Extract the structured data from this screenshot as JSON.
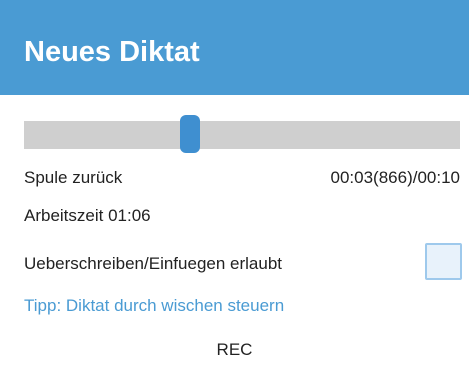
{
  "app_bar": {
    "title": "Neues Diktat",
    "color": "#4a9bd3"
  },
  "player": {
    "seek_progress": 0.38,
    "status": "Spule zurück",
    "time": "00:03(866)/00:10",
    "work_time": "Arbeitszeit 01:06"
  },
  "settings": {
    "overwrite_label": "Ueberschreiben/Einfuegen erlaubt",
    "overwrite_checked": false
  },
  "tip": "Tipp: Diktat durch wischen steuern",
  "rec_label": "REC"
}
